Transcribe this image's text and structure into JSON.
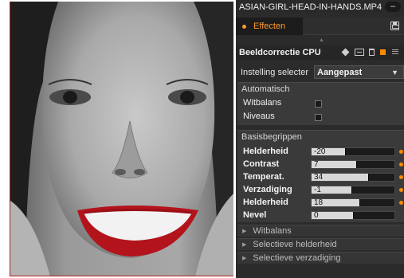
{
  "window": {
    "title": "ASIAN-GIRL-HEAD-IN-HANDS.MP4",
    "minimize_label": "–"
  },
  "tabs": [
    {
      "label": "Effecten",
      "active": true
    }
  ],
  "plugin": {
    "title": "Beeldcorrectie CPU",
    "icons": [
      "diamond-icon",
      "preset-icon",
      "trash-icon",
      "toggle-icon",
      "menu-icon"
    ]
  },
  "preset": {
    "label": "Instelling selecter",
    "value": "Aangepast"
  },
  "automatic": {
    "title": "Automatisch",
    "items": [
      {
        "label": "Witbalans",
        "checked": false
      },
      {
        "label": "Niveaus",
        "checked": false
      }
    ]
  },
  "basics": {
    "title": "Basisbegrippen",
    "sliders": [
      {
        "label": "Helderheid",
        "value": "-20",
        "fill": 0.4,
        "reset": true
      },
      {
        "label": "Contrast",
        "value": "7",
        "fill": 0.54,
        "reset": true
      },
      {
        "label": "Temperat.",
        "value": "34",
        "fill": 0.68,
        "reset": true
      },
      {
        "label": "Verzadiging",
        "value": "-1",
        "fill": 0.48,
        "reset": true
      },
      {
        "label": "Helderheid",
        "value": "18",
        "fill": 0.58,
        "reset": true
      },
      {
        "label": "Nevel",
        "value": "0",
        "fill": 0.5,
        "reset": false
      }
    ]
  },
  "sections": [
    {
      "label": "Witbalans"
    },
    {
      "label": "Selectieve helderheid"
    },
    {
      "label": "Selectieve verzadiging"
    }
  ],
  "colors": {
    "accent": "#ff8a00",
    "panel_bg": "#2b2b2b",
    "group_bg": "#3a3a3a",
    "lip_red": "#b3141c"
  }
}
